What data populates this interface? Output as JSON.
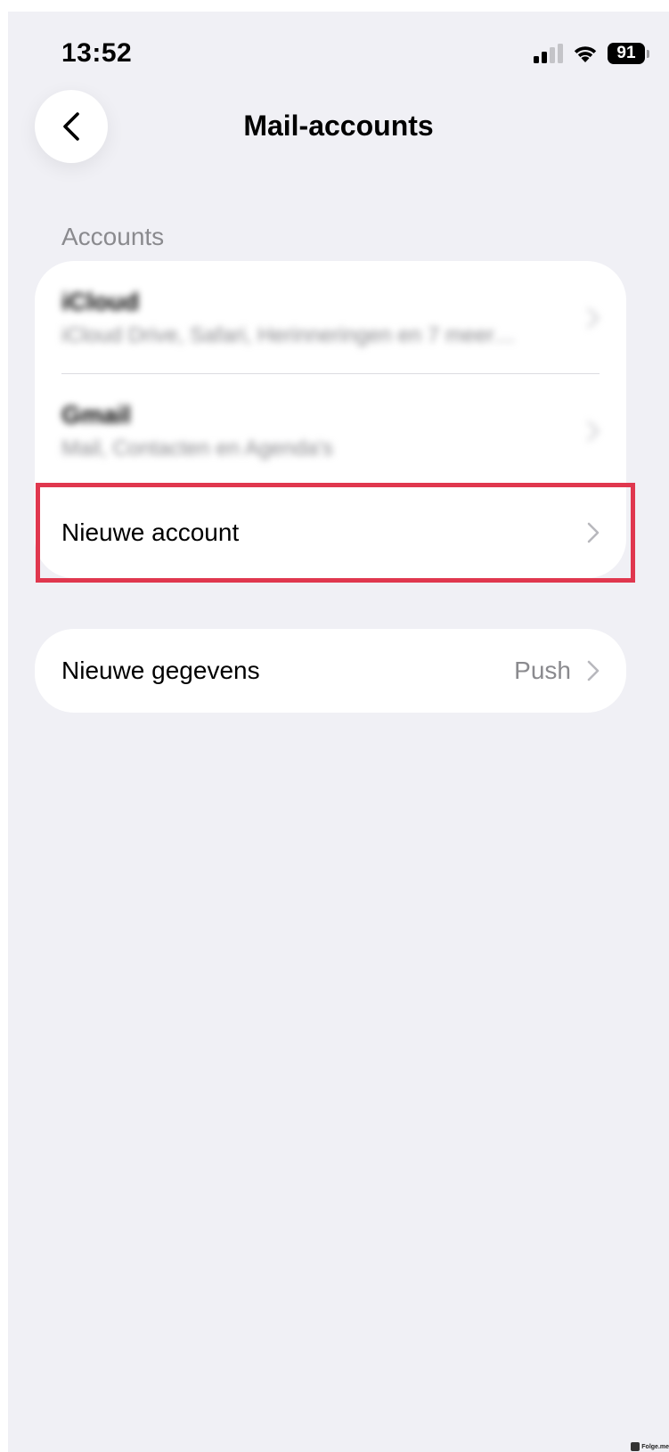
{
  "status_bar": {
    "time": "13:52",
    "battery": "91",
    "icons": [
      "signal-icon",
      "wifi-icon",
      "battery-icon"
    ]
  },
  "nav": {
    "back_icon": "chevron-left-icon",
    "title": "Mail-accounts"
  },
  "accounts_section": {
    "header": "Accounts",
    "items": [
      {
        "title": "iCloud",
        "subtitle": "iCloud Drive, Safari, Herinneringen en 7 meer…"
      },
      {
        "title": "Gmail",
        "subtitle": "Mail, Contacten en Agenda's"
      },
      {
        "title": "Nieuwe account"
      }
    ]
  },
  "fetch_section": {
    "label": "Nieuwe gegevens",
    "value": "Push"
  },
  "highlight_color": "#e0374e",
  "watermark": "Folge.me"
}
